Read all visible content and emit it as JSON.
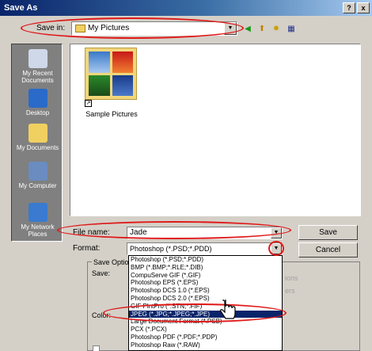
{
  "window": {
    "title": "Save As",
    "help_btn": "?",
    "close_btn": "x"
  },
  "save_in": {
    "label": "Save in:",
    "value": "My Pictures"
  },
  "places": [
    {
      "label": "My Recent Documents",
      "icon": "recent-documents-icon"
    },
    {
      "label": "Desktop",
      "icon": "desktop-icon"
    },
    {
      "label": "My Documents",
      "icon": "my-documents-icon"
    },
    {
      "label": "My Computer",
      "icon": "my-computer-icon"
    },
    {
      "label": "My Network Places",
      "icon": "network-places-icon"
    }
  ],
  "files": [
    {
      "name": "Sample Pictures"
    }
  ],
  "file_name": {
    "label": "File name:",
    "value": "Jade"
  },
  "format": {
    "label": "Format:",
    "value": "Photoshop (*.PSD;*.PDD)",
    "options": [
      "Photoshop (*.PSD;*.PDD)",
      "BMP (*.BMP;*.RLE;*.DIB)",
      "CompuServe GIF (*.GIF)",
      "Photoshop EPS (*.EPS)",
      "Photoshop DCS 1.0 (*.EPS)",
      "Photoshop DCS 2.0 (*.EPS)",
      "GIF PlntPro (*.STN;*.FIF)",
      "JPEG (*.JPG;*.JPEG;*.JPE)",
      "Large Document Format (*.PSB)",
      "PCX (*.PCX)",
      "Photoshop PDF (*.PDF;*.PDP)",
      "Photoshop Raw (*.RAW)"
    ],
    "highlighted_index": 7
  },
  "buttons": {
    "save": "Save",
    "cancel": "Cancel"
  },
  "save_options": {
    "title": "Save Options",
    "save_label": "Save:",
    "color_label": "Color:",
    "greyed": [
      "ions",
      "ers"
    ]
  }
}
